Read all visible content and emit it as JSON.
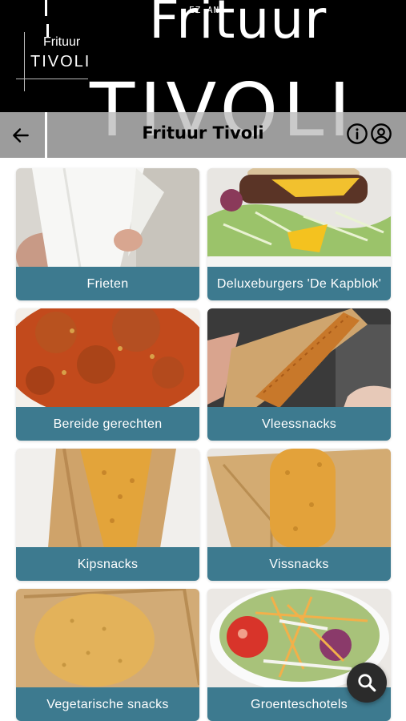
{
  "banner": {
    "headline_1": "Frituur",
    "headline_2": "TIVOLI",
    "tag": "EZ AN",
    "logo_line_1": "Frituur",
    "logo_line_2": "TIVOLI"
  },
  "toolbar": {
    "title": "Frituur Tivoli",
    "back_icon": "arrow-left-icon",
    "info_icon": "info-icon",
    "account_icon": "user-circle-icon"
  },
  "categories": [
    {
      "label": "Frieten",
      "image": "fries-in-paper-cone"
    },
    {
      "label": "Deluxeburgers 'De Kapblok'",
      "image": "burger-with-cheese-and-salad"
    },
    {
      "label": "Bereide gerechten",
      "image": "stew-with-meatballs-in-tomato-sauce"
    },
    {
      "label": "Vleessnacks",
      "image": "fried-meat-snack-in-box"
    },
    {
      "label": "Kipsnacks",
      "image": "fried-chicken-snack-in-box"
    },
    {
      "label": "Vissnacks",
      "image": "fried-fish-snack-in-box"
    },
    {
      "label": "Vegetarische snacks",
      "image": "breaded-veggie-burger-in-box"
    },
    {
      "label": "Groenteschotels",
      "image": "mixed-salad-bowl"
    }
  ],
  "fab": {
    "icon": "search-icon"
  },
  "colors": {
    "accent": "#3d7a8f",
    "banner_bg": "#000000",
    "toolbar_bg": "#bebebe",
    "fab_bg": "#2b2b2b"
  }
}
